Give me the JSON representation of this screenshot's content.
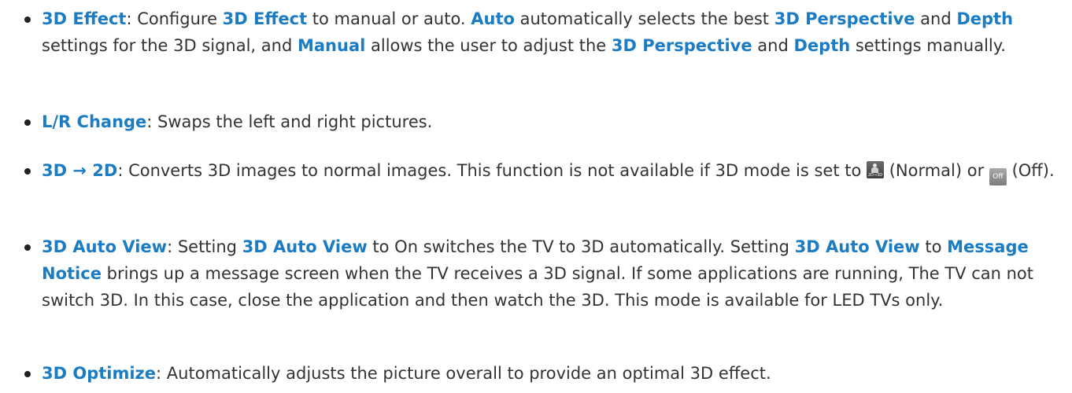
{
  "items": [
    {
      "segments": [
        {
          "text": "3D Effect",
          "style": "key"
        },
        {
          "text": ": Configure ",
          "style": "plain"
        },
        {
          "text": "3D Effect",
          "style": "key"
        },
        {
          "text": " to manual or auto. ",
          "style": "plain"
        },
        {
          "text": "Auto",
          "style": "key"
        },
        {
          "text": " automatically selects the best ",
          "style": "plain"
        },
        {
          "text": "3D Perspective",
          "style": "key"
        },
        {
          "text": " and ",
          "style": "plain"
        },
        {
          "text": "Depth",
          "style": "key"
        },
        {
          "text": " settings for the 3D signal, and ",
          "style": "plain"
        },
        {
          "text": "Manual",
          "style": "key"
        },
        {
          "text": " allows the user to adjust the ",
          "style": "plain"
        },
        {
          "text": "3D Perspective",
          "style": "key"
        },
        {
          "text": " and ",
          "style": "plain"
        },
        {
          "text": "Depth",
          "style": "key"
        },
        {
          "text": " settings manually.",
          "style": "plain"
        }
      ]
    },
    {
      "segments": [
        {
          "text": "L/R Change",
          "style": "key"
        },
        {
          "text": ": Swaps the left and right pictures.",
          "style": "plain"
        }
      ]
    },
    {
      "segments": [
        {
          "text": "3D → 2D",
          "style": "key"
        },
        {
          "text": ": Converts 3D images to normal images. This function is not available if 3D mode is set to ",
          "style": "plain"
        },
        {
          "icon": "normal-2d3d",
          "label": "2D→3D"
        },
        {
          "text": " (Normal) or ",
          "style": "plain"
        },
        {
          "icon": "off",
          "label": "Off"
        },
        {
          "text": " (Off).",
          "style": "plain"
        }
      ]
    },
    {
      "segments": [
        {
          "text": "3D Auto View",
          "style": "key"
        },
        {
          "text": ": Setting ",
          "style": "plain"
        },
        {
          "text": "3D Auto View",
          "style": "key"
        },
        {
          "text": " to On switches the TV to 3D automatically. Setting ",
          "style": "plain"
        },
        {
          "text": "3D Auto View",
          "style": "key"
        },
        {
          "text": " to ",
          "style": "plain"
        },
        {
          "text": "Message Notice",
          "style": "key"
        },
        {
          "text": " brings up a message screen when the TV receives a 3D signal. If some applications are running, The TV can not switch 3D. In this case, close the application and then watch the 3D. This mode is available for LED TVs only.",
          "style": "plain"
        }
      ]
    },
    {
      "segments": [
        {
          "text": "3D Optimize",
          "style": "key"
        },
        {
          "text": ": Automatically adjusts the picture overall to provide an optimal 3D effect.",
          "style": "plain"
        }
      ]
    }
  ],
  "colors": {
    "keyword": "#1b7cc4",
    "body_text": "#333333",
    "bullet": "#222222"
  }
}
